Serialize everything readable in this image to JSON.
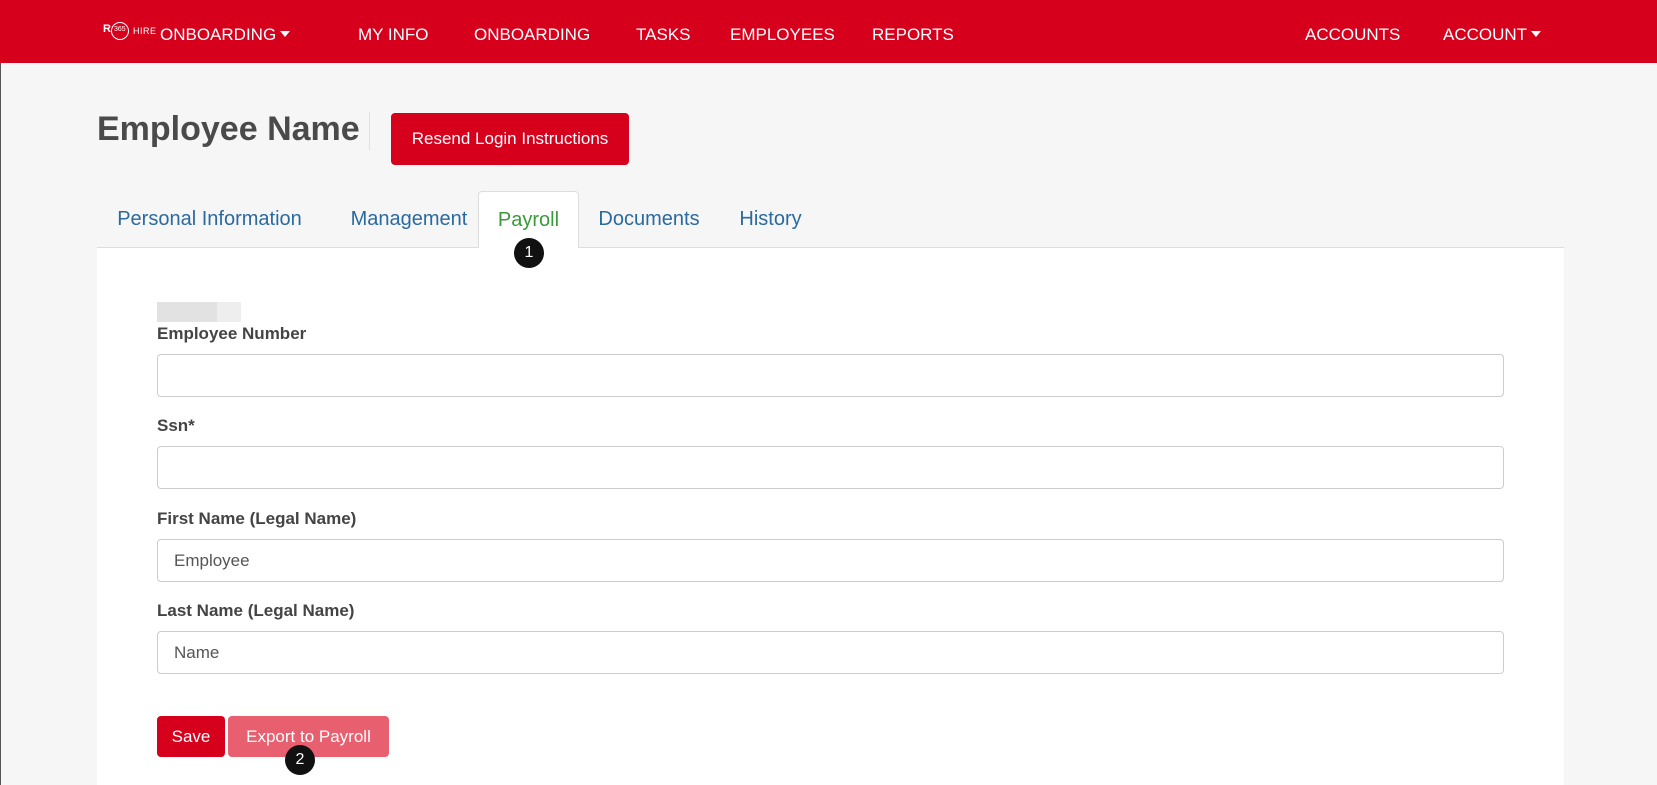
{
  "nav": {
    "logo_text": "HIRE",
    "logo_mark": "R365",
    "brand_menu": "ONBOARDING",
    "items": [
      "MY INFO",
      "ONBOARDING",
      "TASKS",
      "EMPLOYEES",
      "REPORTS"
    ],
    "accounts": "ACCOUNTS",
    "account_menu": "ACCOUNT"
  },
  "header": {
    "title": "Employee Name",
    "resend_button": "Resend Login Instructions"
  },
  "tabs": [
    {
      "label": "Personal Information",
      "active": false
    },
    {
      "label": "Management",
      "active": false
    },
    {
      "label": "Payroll",
      "active": true
    },
    {
      "label": "Documents",
      "active": false
    },
    {
      "label": "History",
      "active": false
    }
  ],
  "markers": {
    "first": "1",
    "second": "2"
  },
  "form": {
    "employee_number": {
      "label": "Employee Number",
      "value": ""
    },
    "ssn": {
      "label": "Ssn*",
      "value": ""
    },
    "first_name": {
      "label": "First Name (Legal Name)",
      "value": "Employee"
    },
    "last_name": {
      "label": "Last Name (Legal Name)",
      "value": "Name"
    }
  },
  "actions": {
    "save": "Save",
    "export": "Export to Payroll"
  },
  "colors": {
    "brand": "#d6001c",
    "active_tab": "#3a9a3a",
    "tab_link": "#2a6a9e",
    "export_disabled": "#e8606f"
  }
}
